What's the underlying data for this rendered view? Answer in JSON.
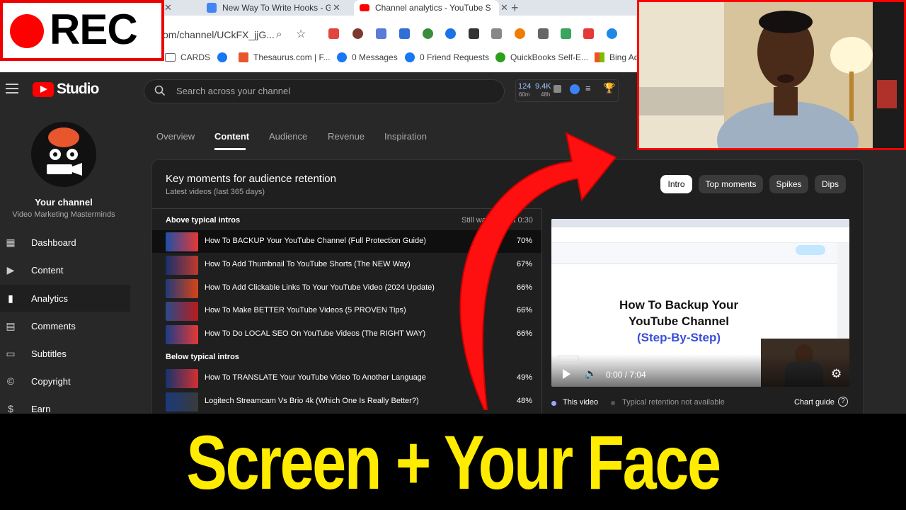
{
  "browser": {
    "tabs": [
      {
        "title": "New Way To Write Hooks - Go"
      },
      {
        "title": "Channel analytics - YouTube S"
      }
    ],
    "address": "om/channel/UCkFX_jjG...",
    "bookmarks": [
      "CARDS",
      "Thesaurus.com | F...",
      "0 Messages",
      "0 Friend Requests",
      "QuickBooks Self-E...",
      "Bing Ad"
    ]
  },
  "studio": {
    "logo_text": "Studio",
    "search": {
      "placeholder": "Search across your channel"
    },
    "stats": {
      "realtime": "124",
      "realtime_period": "60m",
      "views": "9.4K",
      "views_period": "48h"
    }
  },
  "sidebar": {
    "channel_title": "Your channel",
    "channel_name": "Video Marketing Masterminds",
    "items": [
      {
        "label": "Dashboard",
        "icon": "dashboard-icon"
      },
      {
        "label": "Content",
        "icon": "content-icon"
      },
      {
        "label": "Analytics",
        "icon": "analytics-icon",
        "active": true
      },
      {
        "label": "Comments",
        "icon": "comments-icon"
      },
      {
        "label": "Subtitles",
        "icon": "subtitles-icon"
      },
      {
        "label": "Copyright",
        "icon": "copyright-icon"
      },
      {
        "label": "Earn",
        "icon": "earn-icon"
      }
    ]
  },
  "tabs": [
    "Overview",
    "Content",
    "Audience",
    "Revenue",
    "Inspiration"
  ],
  "active_tab": "Content",
  "retention": {
    "title": "Key moments for audience retention",
    "subtitle": "Latest videos (last 365 days)",
    "filters": [
      "Intro",
      "Top moments",
      "Spikes",
      "Dips"
    ],
    "active_filter": "Intro",
    "column_header": "Still watching at 0:30",
    "above_label": "Above typical intros",
    "above": [
      {
        "title": "How To BACKUP Your YouTube Channel (Full Protection Guide)",
        "pct": "70%"
      },
      {
        "title": "How To Add Thumbnail To YouTube Shorts (The NEW Way)",
        "pct": "67%"
      },
      {
        "title": "How To Add Clickable Links To Your YouTube Video (2024 Update)",
        "pct": "66%"
      },
      {
        "title": "How To Make BETTER YouTube Videos (5 PROVEN Tips)",
        "pct": "66%"
      },
      {
        "title": "How To Do LOCAL SEO On YouTube Videos (The RIGHT WAY)",
        "pct": "66%"
      }
    ],
    "below_label": "Below typical intros",
    "below": [
      {
        "title": "How To TRANSLATE Your YouTube Video To Another Language",
        "pct": "49%"
      },
      {
        "title": "Logitech Streamcam Vs Brio 4k (Which One Is Really Better?)",
        "pct": "48%"
      }
    ]
  },
  "preview": {
    "title_line1": "How To Backup Your",
    "title_line2": "YouTube Channel",
    "title_line3": "(Step-By-Step)",
    "time": "0:00 / 7:04"
  },
  "legend": {
    "this_video": "This video",
    "typical": "Typical retention not available",
    "guide": "Chart guide"
  },
  "overlay": {
    "rec": "REC",
    "banner": "Screen + Your Face"
  },
  "colors": {
    "accent_red": "#ff0000",
    "banner_yellow": "#ffec00",
    "studio_bg": "#282828"
  }
}
